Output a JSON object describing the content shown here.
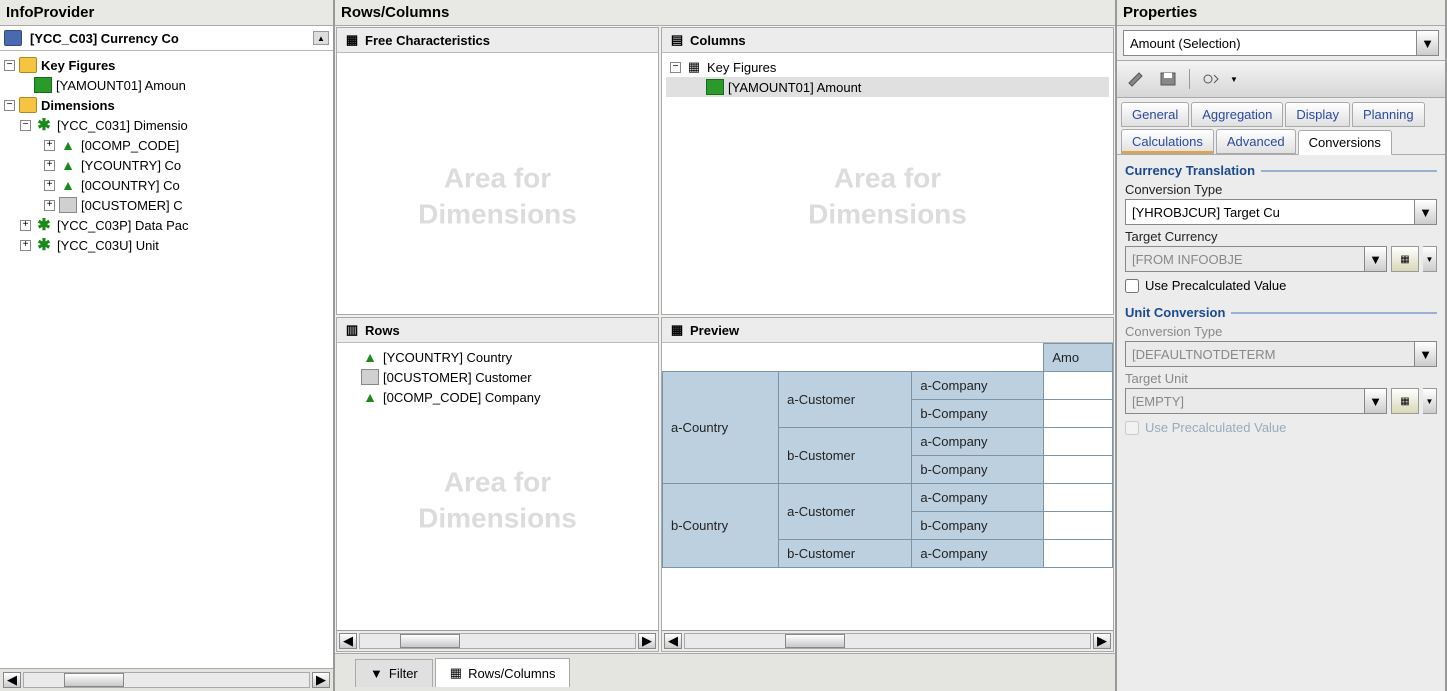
{
  "infoprovider": {
    "title": "InfoProvider",
    "root_label": "[YCC_C03] Currency Co",
    "key_figures_label": "Key Figures",
    "kf_items": [
      "[YAMOUNT01] Amoun"
    ],
    "dimensions_label": "Dimensions",
    "dim1_label": "[YCC_C031] Dimensio",
    "dim1_children": [
      "[0COMP_CODE]",
      "[YCOUNTRY] Co",
      "[0COUNTRY] Co",
      "[0CUSTOMER] C"
    ],
    "dim2_label": "[YCC_C03P] Data Pac",
    "dim3_label": "[YCC_C03U] Unit"
  },
  "rowscols": {
    "title": "Rows/Columns",
    "free_chars": "Free Characteristics",
    "columns_label": "Columns",
    "columns_root": "Key Figures",
    "columns_item": "[YAMOUNT01] Amount",
    "rows_label": "Rows",
    "row_items": [
      "[YCOUNTRY] Country",
      "[0CUSTOMER] Customer",
      "[0COMP_CODE] Company"
    ],
    "preview_label": "Preview",
    "watermark": "Area for Dimensions",
    "amt_header": "Amo",
    "preview_cells": {
      "c0": "a-Country",
      "c1": "b-Country",
      "cu_a": "a-Customer",
      "cu_b": "b-Customer",
      "co_a": "a-Company",
      "co_b": "b-Company"
    },
    "tabs": {
      "filter": "Filter",
      "rowscols": "Rows/Columns"
    }
  },
  "properties": {
    "title": "Properties",
    "selector": "Amount (Selection)",
    "tabs": {
      "general": "General",
      "aggregation": "Aggregation",
      "display": "Display",
      "planning": "Planning",
      "calculations": "Calculations",
      "advanced": "Advanced",
      "conversions": "Conversions"
    },
    "group_currency": "Currency Translation",
    "conv_type_label": "Conversion Type",
    "conv_type_value": "[YHROBJCUR] Target Cu",
    "target_currency_label": "Target Currency",
    "target_currency_value": "[FROM INFOOBJE",
    "use_precalc": "Use Precalculated Value",
    "group_unit": "Unit Conversion",
    "unit_conv_type_label": "Conversion Type",
    "unit_conv_type_value": "[DEFAULTNOTDETERM",
    "target_unit_label": "Target Unit",
    "target_unit_value": "[EMPTY]",
    "use_precalc2": "Use Precalculated Value"
  }
}
